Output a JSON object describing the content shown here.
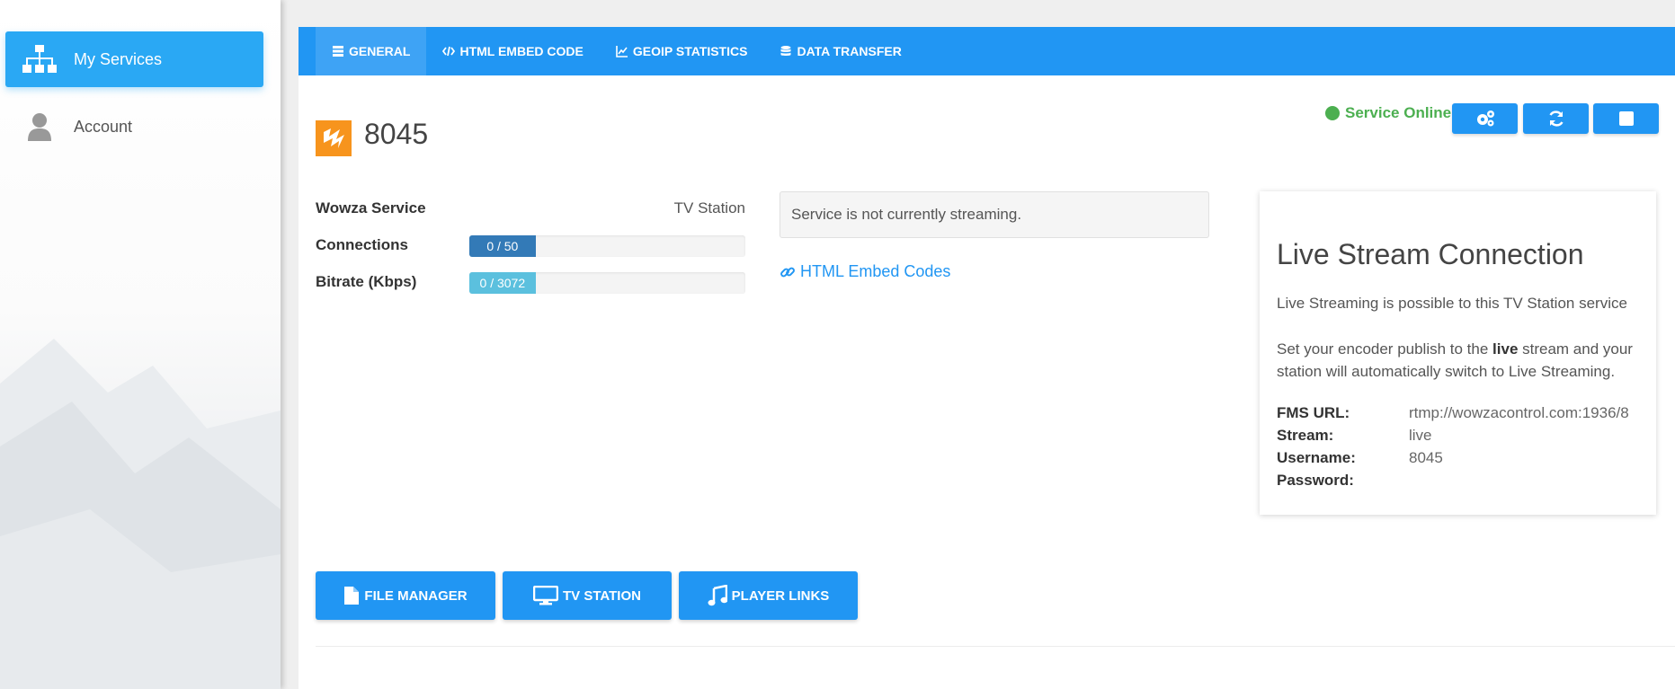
{
  "sidebar": {
    "items": [
      {
        "label": "My Services",
        "icon": "sitemap-icon",
        "active": true
      },
      {
        "label": "Account",
        "icon": "user-icon",
        "active": false
      }
    ]
  },
  "tabs": [
    {
      "label": "GENERAL",
      "icon": "database-icon",
      "active": true
    },
    {
      "label": "HTML EMBED CODE",
      "icon": "code-icon",
      "active": false
    },
    {
      "label": "GEOIP STATISTICS",
      "icon": "chart-line-icon",
      "active": false
    },
    {
      "label": "DATA TRANSFER",
      "icon": "database-icon",
      "active": false
    }
  ],
  "service": {
    "title": "8045",
    "status": "Service Online",
    "controls": [
      {
        "name": "settings",
        "icon": "cogs-icon"
      },
      {
        "name": "restart",
        "icon": "refresh-icon"
      },
      {
        "name": "stop",
        "icon": "stop-icon"
      }
    ]
  },
  "stats": {
    "wowza_label": "Wowza Service",
    "wowza_value": "TV Station",
    "connections_label": "Connections",
    "connections_text": "0 / 50",
    "connections_fraction": 0.0,
    "bitrate_label": "Bitrate (Kbps)",
    "bitrate_text": "0 / 3072",
    "bitrate_fraction": 0.0
  },
  "notice": "Service is not currently streaming.",
  "embed_link": "HTML Embed Codes",
  "live_card": {
    "title": "Live Stream Connection",
    "p1": "Live Streaming is possible to this TV Station service",
    "p2_before": "Set your encoder publish to the ",
    "p2_bold": "live",
    "p2_after": " stream and your station will automatically switch to Live Streaming.",
    "fms_label": "FMS URL:",
    "fms_value": "rtmp://wowzacontrol.com:1936/8",
    "stream_label": "Stream:",
    "stream_value": "live",
    "username_label": "Username:",
    "username_value": "8045",
    "password_label": "Password:",
    "password_value": ""
  },
  "buttons": {
    "file_manager": "FILE MANAGER",
    "tv_station": "TV STATION",
    "player_links": "PLAYER LINKS"
  },
  "colors": {
    "primary": "#2196f3",
    "sidebar_active": "#2aa8f4",
    "online": "#4caf50",
    "logo": "#f7941d",
    "bar_connections": "#337ab7",
    "bar_bitrate": "#5bc0de"
  }
}
